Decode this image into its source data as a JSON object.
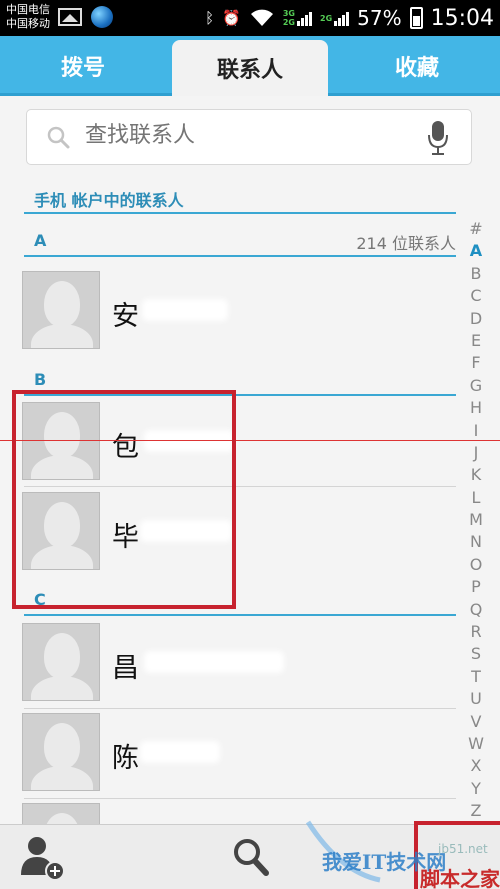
{
  "status_bar": {
    "carriers": [
      "中国电信",
      "中国移动"
    ],
    "net_top": "3G",
    "net_bottom": "2G",
    "net_right": "2G",
    "battery": "57%",
    "time": "15:04"
  },
  "tabs": [
    {
      "label": "拨号",
      "active": false
    },
    {
      "label": "联系人",
      "active": true
    },
    {
      "label": "收藏",
      "active": false
    }
  ],
  "search": {
    "placeholder": "查找联系人"
  },
  "section_title": "手机 帐户中的联系人",
  "count_text": "214 位联系人",
  "groups": [
    {
      "letter": "A",
      "contacts": [
        {
          "name": "安"
        }
      ]
    },
    {
      "letter": "B",
      "contacts": [
        {
          "name": "包"
        },
        {
          "name": "毕"
        }
      ]
    },
    {
      "letter": "C",
      "contacts": [
        {
          "name": "昌"
        },
        {
          "name": "陈"
        }
      ]
    }
  ],
  "alphabet": [
    "#",
    "A",
    "B",
    "C",
    "D",
    "E",
    "F",
    "G",
    "H",
    "I",
    "J",
    "K",
    "L",
    "M",
    "N",
    "O",
    "P",
    "Q",
    "R",
    "S",
    "T",
    "U",
    "V",
    "W",
    "X",
    "Y",
    "Z"
  ],
  "alphabet_active": "A",
  "icons": {
    "add_contact": "add-contact-icon",
    "search": "search-icon",
    "mic": "mic-icon"
  },
  "watermark": {
    "text": "我爱IT技术网",
    "url": "jb51.net",
    "brand": "脚本之家"
  },
  "colors": {
    "accent": "#43b6e6",
    "section": "#2d8db7",
    "highlight": "#c7222e"
  }
}
